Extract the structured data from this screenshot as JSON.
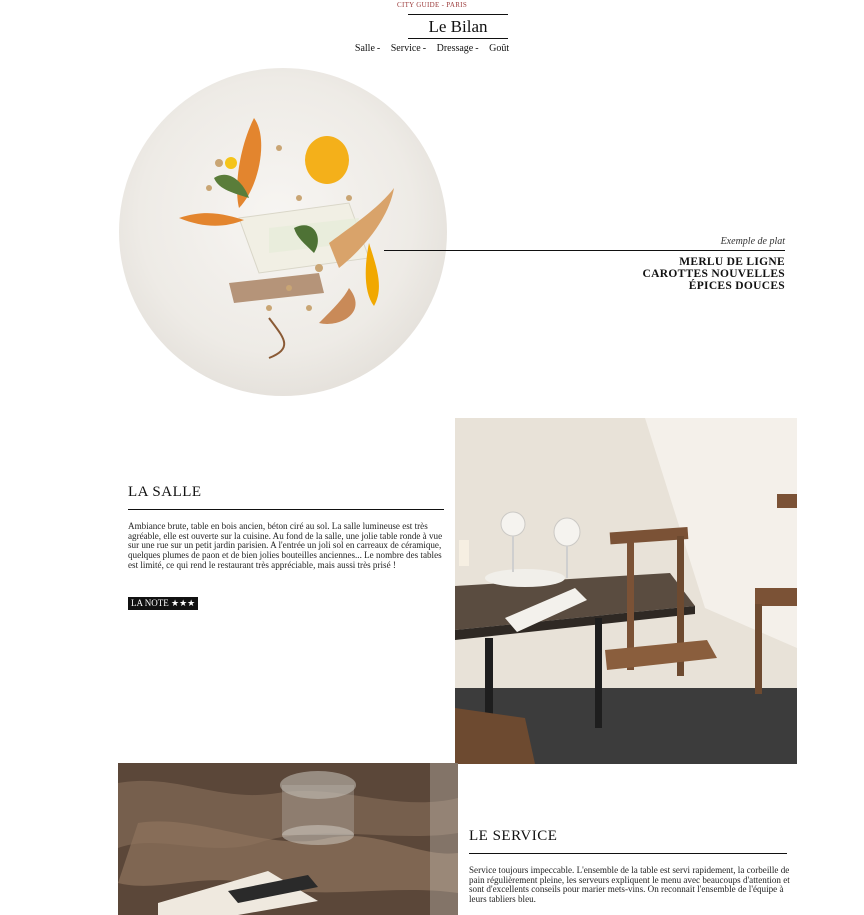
{
  "header": {
    "kicker": "CITY GUIDE - PARIS",
    "brand": "Le Bilan",
    "nav": [
      {
        "label": "Salle",
        "sep": "-"
      },
      {
        "label": "Service",
        "sep": "-"
      },
      {
        "label": "Dressage",
        "sep": "-"
      },
      {
        "label": "Goût",
        "sep": ""
      }
    ]
  },
  "dish": {
    "caption": "Exemple de plat",
    "name_lines": [
      "MERLU DE LIGNE",
      "CAROTTES NOUVELLES",
      "ÉPICES DOUCES"
    ]
  },
  "salle": {
    "title": "LA SALLE",
    "text": "Ambiance brute, table en bois ancien, béton ciré au sol. La salle lumineuse est très agréable, elle est ouverte sur la cuisine. Au fond de la salle, une jolie table ronde à vue sur une rue sur un petit jardin parisien. A l'entrée un joli sol en carreaux de céramique, quelques plumes de paon et de bien jolies bouteilles anciennes... Le nombre des tables est limité, ce qui rend le restaurant très appréciable, mais aussi très prisé !",
    "note": "LA NOTE ★★★"
  },
  "service": {
    "title": "LE SERVICE",
    "text": "Service toujours impeccable. L'ensemble de la table est servi rapidement, la corbeille de pain régulièrement pleine, les serveurs expliquent le menu avec beaucoups d'attention et sont d'excellents conseils pour marier mets-vins. On reconnait l'ensemble de l'équipe à leurs tabliers bleu."
  },
  "colors": {
    "kicker": "#9b3a3a",
    "note_bg": "#111111",
    "text": "#111111"
  }
}
